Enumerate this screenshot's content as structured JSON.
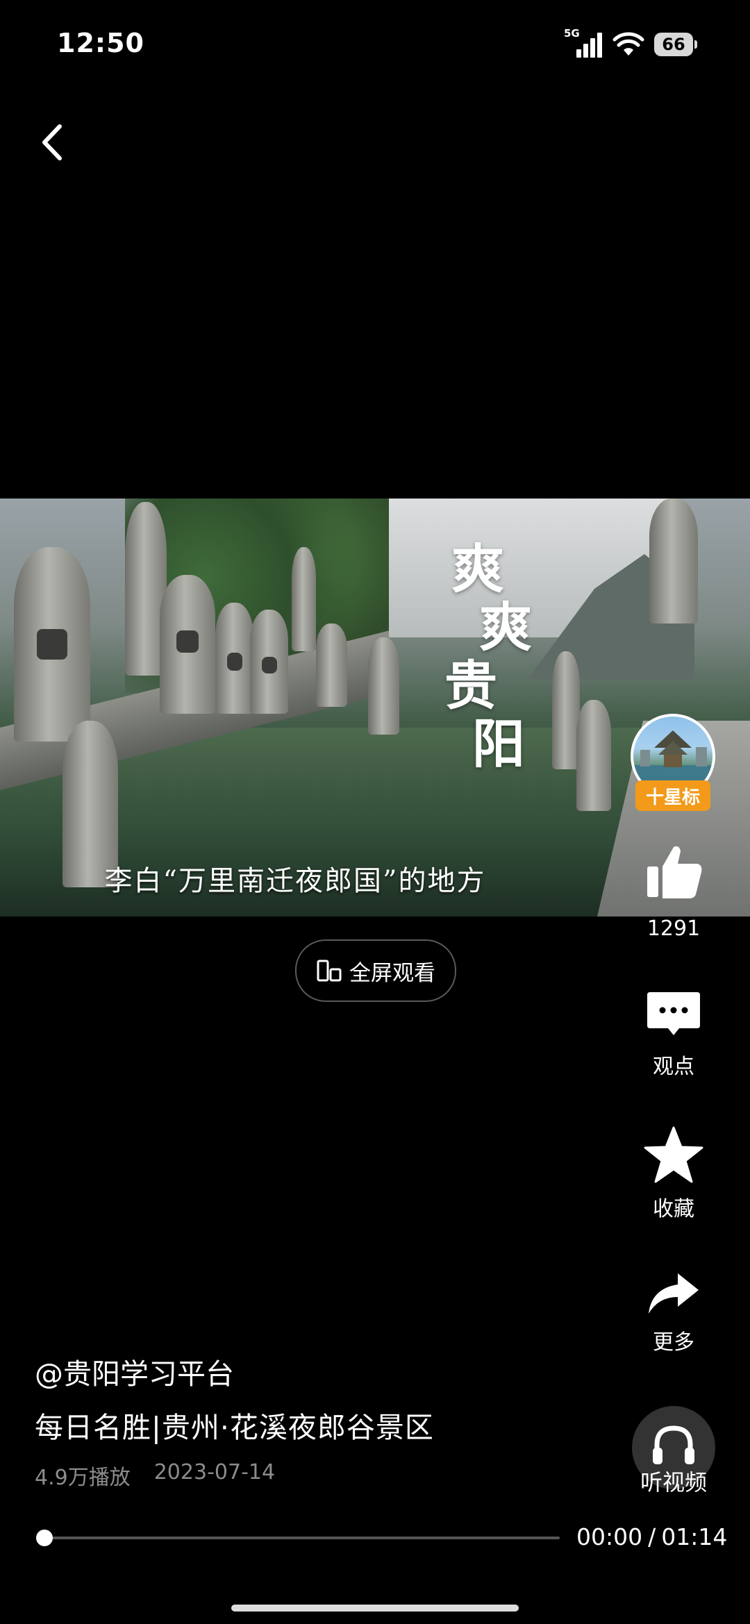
{
  "status_bar": {
    "time": "12:50",
    "network": "5G",
    "battery": "66"
  },
  "video": {
    "title_overlay": [
      "爽",
      "爽",
      "贵",
      "阳"
    ],
    "subtitle": "李白“万里南迁夜郎国”的地方"
  },
  "fullscreen": {
    "label": "全屏观看"
  },
  "actions": {
    "follow_label": "十星标",
    "like_count": "1291",
    "comment_label": "观点",
    "favorite_label": "收藏",
    "share_label": "更多",
    "listen_label": "听视频"
  },
  "info": {
    "author": "@贵阳学习平台",
    "title": "每日名胜|贵州·花溪夜郎谷景区",
    "plays": "4.9万播放",
    "date": "2023-07-14"
  },
  "player": {
    "current": "00:00",
    "separator": "/",
    "duration": "01:14",
    "progress": 0.0
  },
  "icons": [
    "back-arrow-icon",
    "signal-icon",
    "wifi-icon",
    "battery-icon",
    "phone-rotate-icon",
    "like-icon",
    "comment-icon",
    "star-icon",
    "share-icon",
    "headphones-icon"
  ]
}
